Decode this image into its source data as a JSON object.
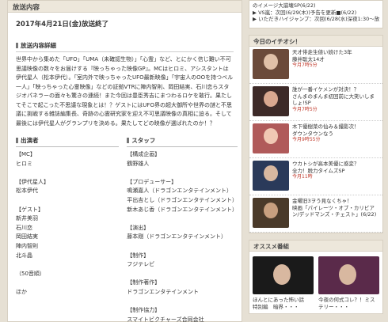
{
  "main": {
    "header": "放送内容",
    "broadcast": "2017年4月21日(金)放送終了",
    "details_title": "放送内容詳細",
    "description": "世界中から集めた「UFO」「UMA（未確認生物）」「心霊」など、とにかく信じ難い不可思議映像の数々をお届けする『映っちゃった映像GP』。MCはヒロミ、アシスタントは伊代星人（松本伊代）。「室内外で映っちゃったUFO最新映像」「宇宙人のOOを持つベル一人」「映っちゃった心霊映像」などの証拠VTRに陣内智則、岡田結実、石川恋らスタジオパネラーの面々も驚きの連続！また今回は豊臣秀吉にまつわるロケを敢行。果たしてそこで起こった不思議な現象とは！？ゲストにはUFO界の超大御所や世界の謎と不思議に挑戦する雑誌編集長、奇跡の心霊研究家を迎え不可思議映像の真相に迫る。そして最後には伊代星人がグランプリを決める。果たしてどの映像が選ばれたのか！？",
    "cast": {
      "heading": "出演者",
      "lines": [
        "【MC】",
        "ヒロミ",
        "",
        "【伊代星人】",
        "松本伊代",
        "",
        "【ゲスト】",
        "新井美羽",
        "石川恋",
        "岡田結実",
        "陣内智則",
        "北斗晶",
        "",
        "（50音順）",
        "",
        "ほか"
      ]
    },
    "staff": {
      "heading": "スタッフ",
      "lines": [
        "【構成企画】",
        "鶴野雄人",
        "",
        "【プロデューサー】",
        "鳴瀬嘉人（ドラゴンエンタテインメント）",
        "平出吉とし（ドラゴンエンタテインメント）",
        "新木あじ香（ドラゴンエンタテインメント）",
        "",
        "【演出】",
        "藤本剛（ドラゴンエンタテインメント）",
        "",
        "【制作】",
        "フジテレビ",
        "",
        "【制作著作】",
        "ドラゴンエンタテインメント",
        "",
        "【制作協力】",
        "スマイトビクチャーズ合同会社"
      ]
    }
  },
  "sidebar": {
    "topics": [
      {
        "text": "のイメージ大崩壊SP(6/22)",
        "red": false
      },
      {
        "text": "▶ VS嵐：次回(6/29(木))予告を更新■(6/22)",
        "red": false
      },
      {
        "text": "▶ いただきハイジャンプ：次回(6/28(水)深夜1:30〜放送)予告を更新！(6/22)",
        "red": false
      }
    ],
    "pickup_title": "今日のイチオシ！",
    "pickup": [
      {
        "line1": "天才俳走生値い続けた3年",
        "line2": "藤井聡太14才",
        "views": "今月7時5分"
      },
      {
        "line1": "誰が一番イケメンが対決！？",
        "line2": "さんまのまんま初回前に大笑いしましょ!SP",
        "views": "今月7時5分"
      },
      {
        "line1": "木下優樹菜の仙み＆撮影次！",
        "line2": "ダウンタウンなう",
        "views": "今月9時55分"
      },
      {
        "line1": "ウカトシが高本美優に惑変？",
        "line2": "全力！脱力タイムズSP",
        "views": "今月11時"
      },
      {
        "line1": "金曜旧3ヲう見なくちゃ！",
        "line2": "映画「パイレーツ・オブ・カリビアン/デッドマンズ・チェスト」(6/22)",
        "views": ""
      }
    ],
    "recommend_title": "オススメ番組",
    "recommend": [
      {
        "title": "ほんとにあった怖い話　特別編　暗界・・・"
      },
      {
        "title": "今夜の何式コレ？！ミステリー・・・"
      }
    ],
    "colors": {
      "accent": "#c0392b",
      "header_bg": "#ede7db",
      "page_bg": "#e6e0d4"
    }
  }
}
